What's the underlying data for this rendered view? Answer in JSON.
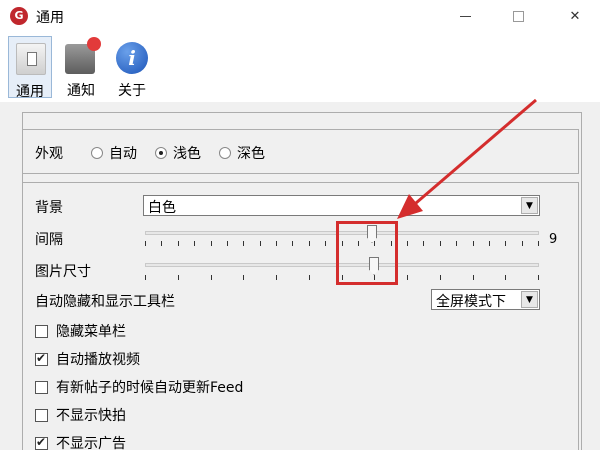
{
  "window": {
    "title": "通用",
    "app_icon_letter": "G",
    "minimize_glyph": "—",
    "close_glyph": "✕"
  },
  "toolbar": {
    "items": [
      {
        "label": "通用",
        "icon": "switch-icon",
        "selected": true
      },
      {
        "label": "通知",
        "icon": "notification-icon",
        "selected": false
      },
      {
        "label": "关于",
        "icon": "info-icon",
        "selected": false
      }
    ]
  },
  "appearance": {
    "label": "外观",
    "options": [
      {
        "label": "自动",
        "selected": false
      },
      {
        "label": "浅色",
        "selected": true
      },
      {
        "label": "深色",
        "selected": false
      }
    ]
  },
  "settings": {
    "background": {
      "label": "背景",
      "value": "白色"
    },
    "spacing": {
      "label": "间隔",
      "max_label": "9"
    },
    "image_size": {
      "label": "图片尺寸"
    },
    "toolbar_autohide": {
      "label": "自动隐藏和显示工具栏",
      "value": "全屏模式下"
    },
    "checkboxes": [
      {
        "label": "隐藏菜单栏",
        "checked": false
      },
      {
        "label": "自动播放视频",
        "checked": true
      },
      {
        "label": "有新帖子的时候自动更新Feed",
        "checked": false
      },
      {
        "label": "不显示快拍",
        "checked": false
      },
      {
        "label": "不显示广告",
        "checked": true
      }
    ]
  },
  "colors": {
    "annotation": "#d42d2d",
    "selected_tab_bg": "#e6eef8"
  }
}
